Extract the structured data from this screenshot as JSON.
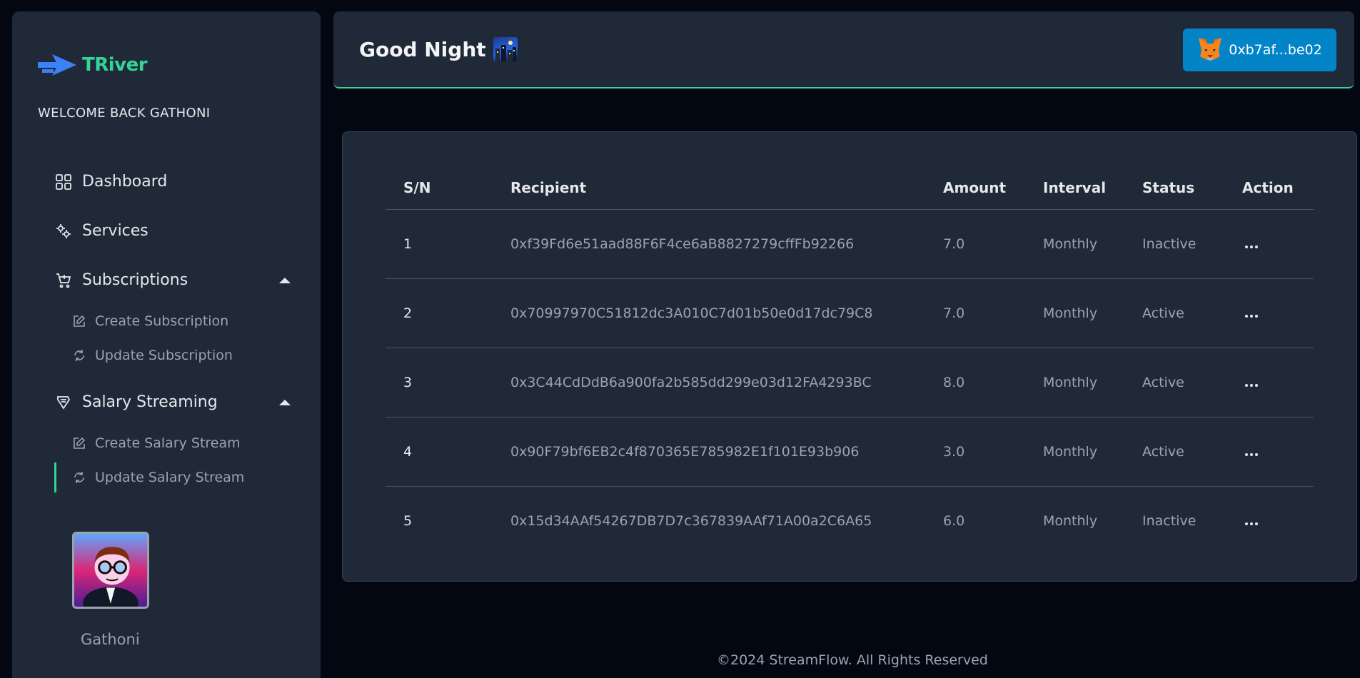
{
  "brand": {
    "name": "TRiver",
    "welcome": "WELCOME BACK GATHONI",
    "accent": "#34d399"
  },
  "nav": {
    "dashboard": "Dashboard",
    "services": "Services",
    "subscriptions": "Subscriptions",
    "create_subscription": "Create Subscription",
    "update_subscription": "Update Subscription",
    "salary_streaming": "Salary Streaming",
    "create_salary_stream": "Create Salary Stream",
    "update_salary_stream": "Update Salary Stream"
  },
  "user": {
    "name": "Gathoni"
  },
  "header": {
    "greeting": "Good Night",
    "wallet": "0xb7af...be02",
    "wallet_color": "#0284c7"
  },
  "table": {
    "columns": [
      "S/N",
      "Recipient",
      "Amount",
      "Interval",
      "Status",
      "Action"
    ],
    "rows": [
      {
        "sn": "1",
        "recipient": "0xf39Fd6e51aad88F6F4ce6aB8827279cffFb92266",
        "amount": "7.0",
        "interval": "Monthly",
        "status": "Inactive"
      },
      {
        "sn": "2",
        "recipient": "0x70997970C51812dc3A010C7d01b50e0d17dc79C8",
        "amount": "7.0",
        "interval": "Monthly",
        "status": "Active"
      },
      {
        "sn": "3",
        "recipient": "0x3C44CdDdB6a900fa2b585dd299e03d12FA4293BC",
        "amount": "8.0",
        "interval": "Monthly",
        "status": "Active"
      },
      {
        "sn": "4",
        "recipient": "0x90F79bf6EB2c4f870365E785982E1f101E93b906",
        "amount": "3.0",
        "interval": "Monthly",
        "status": "Active"
      },
      {
        "sn": "5",
        "recipient": "0x15d34AAf54267DB7D7c367839AAf71A00a2C6A65",
        "amount": "6.0",
        "interval": "Monthly",
        "status": "Inactive"
      }
    ]
  },
  "footer": "©2024 StreamFlow. All Rights Reserved"
}
